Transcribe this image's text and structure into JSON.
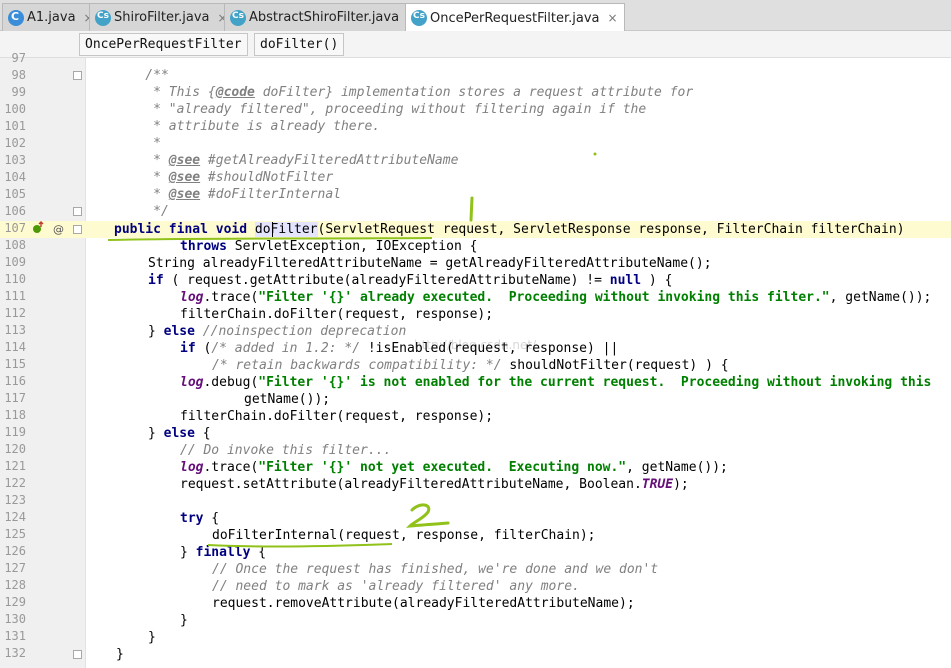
{
  "tabs": [
    {
      "label": "A1.java",
      "icon": "java-class-icon",
      "active": false
    },
    {
      "label": "ShiroFilter.java",
      "icon": "java-class-icon",
      "active": false
    },
    {
      "label": "AbstractShiroFilter.java",
      "icon": "java-class-icon",
      "active": false
    },
    {
      "label": "OncePerRequestFilter.java",
      "icon": "java-class-icon",
      "active": true
    }
  ],
  "tab_close_glyph": "×",
  "breadcrumb": [
    "OncePerRequestFilter",
    "doFilter()"
  ],
  "gutter_markers": {
    "override_icon": "override-icon",
    "annotation": "@"
  },
  "watermark": "http://blog.csdn.net/",
  "annotations": [
    "1",
    "2"
  ],
  "highlight_color": "#90c21a",
  "line_numbers": [
    "97",
    "98",
    "99",
    "100",
    "101",
    "102",
    "103",
    "104",
    "105",
    "106",
    "107",
    "108",
    "109",
    "110",
    "111",
    "112",
    "113",
    "114",
    "115",
    "116",
    "117",
    "118",
    "119",
    "120",
    "121",
    "122",
    "123",
    "124",
    "125",
    "126",
    "127",
    "128",
    "129",
    "130",
    "131",
    "132"
  ],
  "code": {
    "l98": "    /**",
    "l99a": "     * This {",
    "l99tag": "@code",
    "l99b": " doFilter} implementation stores a request attribute for",
    "l100": "     * \"already filtered\", proceeding without filtering again if the",
    "l101": "     * attribute is already there.",
    "l102": "     *",
    "l103a": "     * ",
    "l103tag": "@see",
    "l103b": " #getAlreadyFilteredAttributeName",
    "l104a": "     * ",
    "l104tag": "@see",
    "l104b": " #shouldNotFilter",
    "l105a": "     * ",
    "l105tag": "@see",
    "l105b": " #doFilterInternal",
    "l106": "     */",
    "l107kw": "public final void",
    "l107hl": "doFilter",
    "l107rest": "(ServletRequest request, ServletResponse response, FilterChain filterChain)",
    "l108kw": "throws",
    "l108rest": " ServletException, IOException {",
    "l109": "String alreadyFilteredAttributeName = getAlreadyFilteredAttributeName();",
    "l110kw": "if",
    "l110rest": " ( request.getAttribute(alreadyFilteredAttributeName) != ",
    "l110kw2": "null",
    "l110end": " ) {",
    "l111fld": "log",
    "l111a": ".trace(",
    "l111str": "\"Filter '{}' already executed.  Proceeding without invoking this filter.\"",
    "l111b": ", getName());",
    "l112": "filterChain.doFilter(request, response);",
    "l113a": "} ",
    "l113kw": "else",
    "l113cm": " //noinspection deprecation",
    "l114kw": "if",
    "l114a": " (",
    "l114cm": "/* added in 1.2: */",
    "l114b": " !isEnabled(request, response) ||",
    "l115cm": "/* retain backwards compatibility: */",
    "l115b": " shouldNotFilter(request) ) {",
    "l116fld": "log",
    "l116a": ".debug(",
    "l116str": "\"Filter '{}' is not enabled for the current request.  Proceeding without invoking this",
    "l117": "getName());",
    "l118": "filterChain.doFilter(request, response);",
    "l119a": "} ",
    "l119kw": "else",
    "l119b": " {",
    "l120": "// Do invoke this filter...",
    "l121fld": "log",
    "l121a": ".trace(",
    "l121str": "\"Filter '{}' not yet executed.  Executing now.\"",
    "l121b": ", getName());",
    "l122a": "request.setAttribute(alreadyFilteredAttributeName, Boolean.",
    "l122cst": "TRUE",
    "l122b": ");",
    "l124kw": "try",
    "l124b": " {",
    "l125": "doFilterInternal(request, response, filterChain);",
    "l126a": "} ",
    "l126kw": "finally",
    "l126b": " {",
    "l127": "// Once the request has finished, we're done and we don't",
    "l128": "// need to mark as 'already filtered' any more.",
    "l129": "request.removeAttribute(alreadyFilteredAttributeName);",
    "l130": "}",
    "l131": "}",
    "l132": "}"
  }
}
